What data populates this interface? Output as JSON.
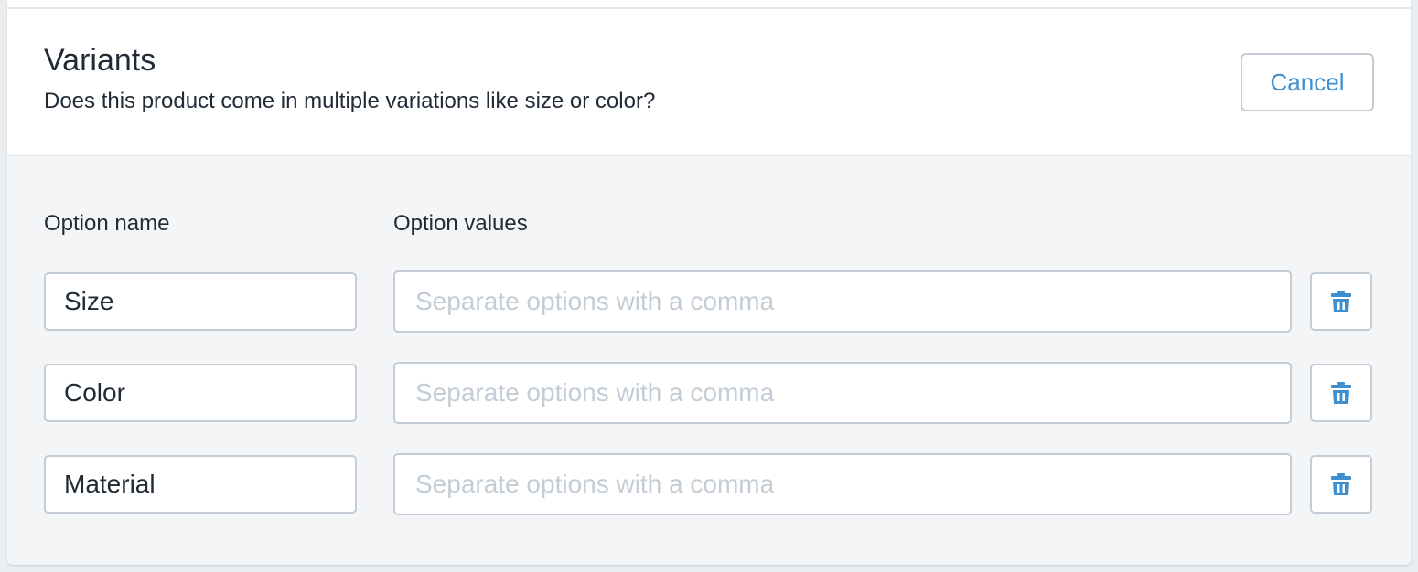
{
  "variants": {
    "title": "Variants",
    "subtitle": "Does this product come in multiple variations like size or color?",
    "cancel_label": "Cancel"
  },
  "columns": {
    "option_name": "Option name",
    "option_values": "Option values"
  },
  "options": [
    {
      "name": "Size",
      "values": "",
      "values_placeholder": "Separate options with a comma",
      "delete_icon": "trash-icon"
    },
    {
      "name": "Color",
      "values": "",
      "values_placeholder": "Separate options with a comma",
      "delete_icon": "trash-icon"
    },
    {
      "name": "Material",
      "values": "",
      "values_placeholder": "Separate options with a comma",
      "delete_icon": "trash-icon"
    }
  ],
  "colors": {
    "accent": "#3d8fcf",
    "text": "#212b36",
    "border": "#c4cdd5",
    "placeholder": "#c4cdd5",
    "section_background": "#f4f5f7"
  }
}
